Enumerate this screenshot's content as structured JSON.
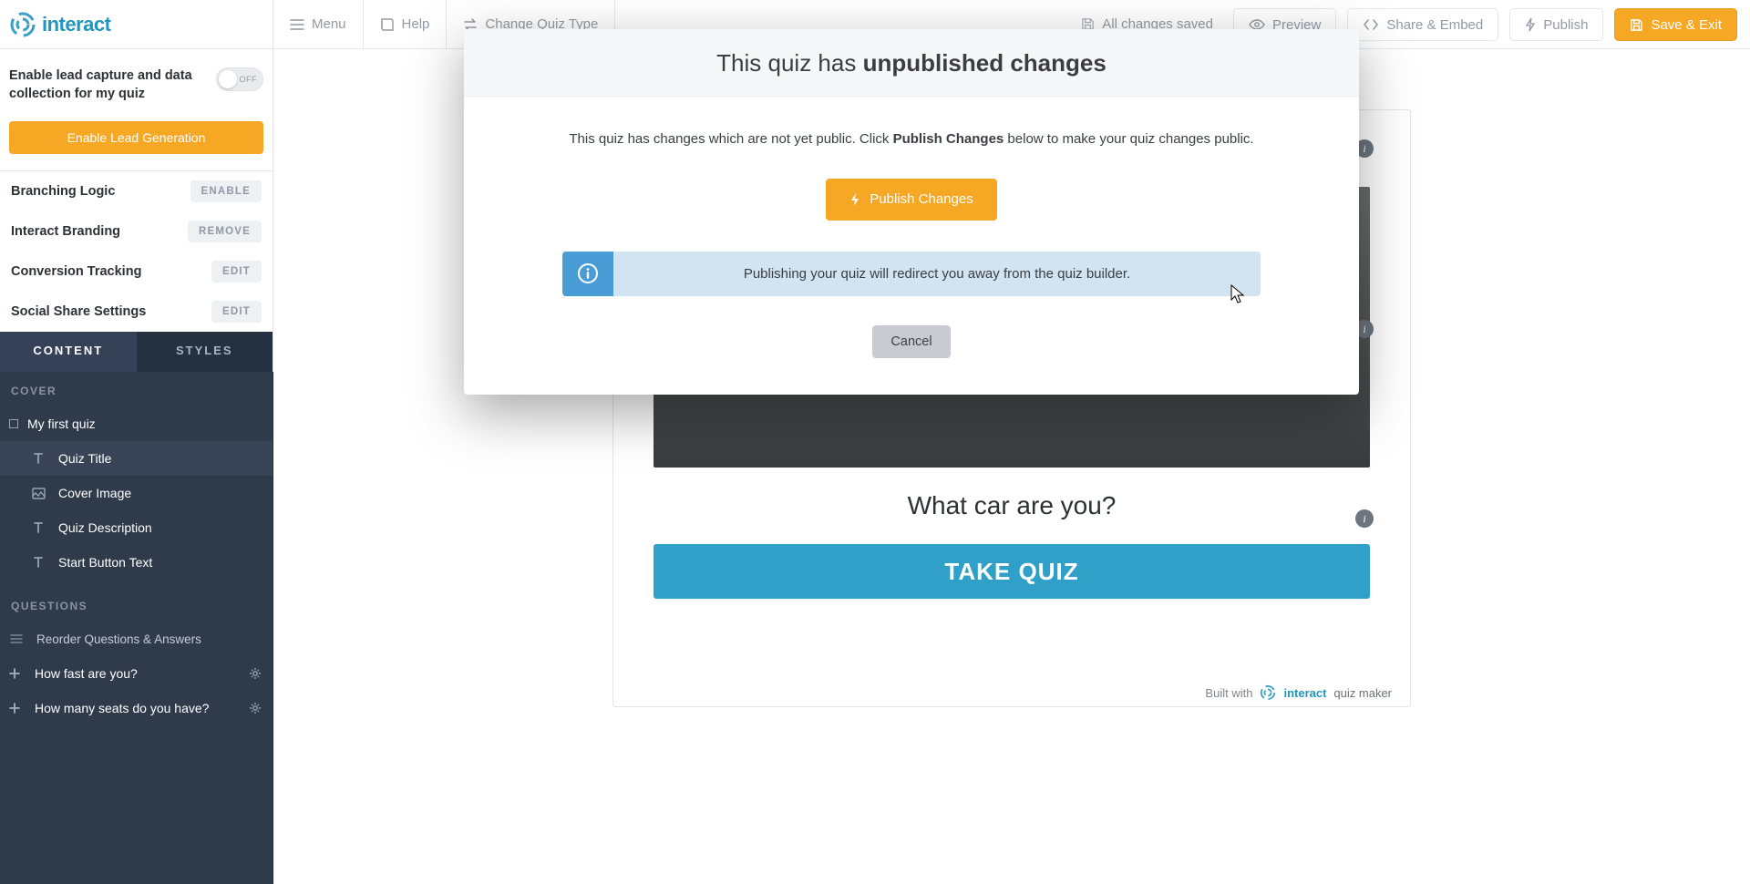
{
  "brand": {
    "word_mark": "interact",
    "quiz_maker_suffix": "quiz maker"
  },
  "topbar": {
    "menu": "Menu",
    "help": "Help",
    "change_quiz_type": "Change Quiz Type",
    "saved_status": "All changes saved",
    "preview": "Preview",
    "share_embed": "Share & Embed",
    "publish": "Publish",
    "save_exit": "Save & Exit"
  },
  "sidebar": {
    "lead_label_line1": "Enable lead capture and data",
    "lead_label_line2": "collection for my quiz",
    "toggle_off": "OFF",
    "lead_button": "Enable Lead Generation",
    "settings": [
      {
        "label": "Branching Logic",
        "pill": "ENABLE"
      },
      {
        "label": "Interact Branding",
        "pill": "REMOVE"
      },
      {
        "label": "Conversion Tracking",
        "pill": "EDIT"
      },
      {
        "label": "Social Share Settings",
        "pill": "EDIT"
      }
    ],
    "tabs": {
      "content": "CONTENT",
      "styles": "STYLES"
    },
    "cover_label": "COVER",
    "cover_items": {
      "root": "My first quiz",
      "title": "Quiz Title",
      "image": "Cover Image",
      "description": "Quiz Description",
      "start_btn": "Start Button Text"
    },
    "questions_label": "QUESTIONS",
    "questions": {
      "reorder": "Reorder Questions & Answers",
      "q1": "How fast are you?",
      "q2": "How many seats do you have?"
    }
  },
  "canvas": {
    "question_text": "What car are you?",
    "take_quiz": "TAKE QUIZ",
    "tip_glyph": "i",
    "built_with": "Built with"
  },
  "modal": {
    "title_prefix": "This quiz has ",
    "title_strong": "unpublished changes",
    "explain_before": "This quiz has changes which are not yet public. Click ",
    "explain_strong": "Publish Changes",
    "explain_after": " below to make your quiz changes public.",
    "publish_changes": "Publish Changes",
    "info_text": "Publishing your quiz will redirect you away from the quiz builder.",
    "cancel": "Cancel"
  },
  "colors": {
    "orange": "#f6a724",
    "take_blue": "#30a0c9",
    "info_blue": "#d2e4f2"
  }
}
